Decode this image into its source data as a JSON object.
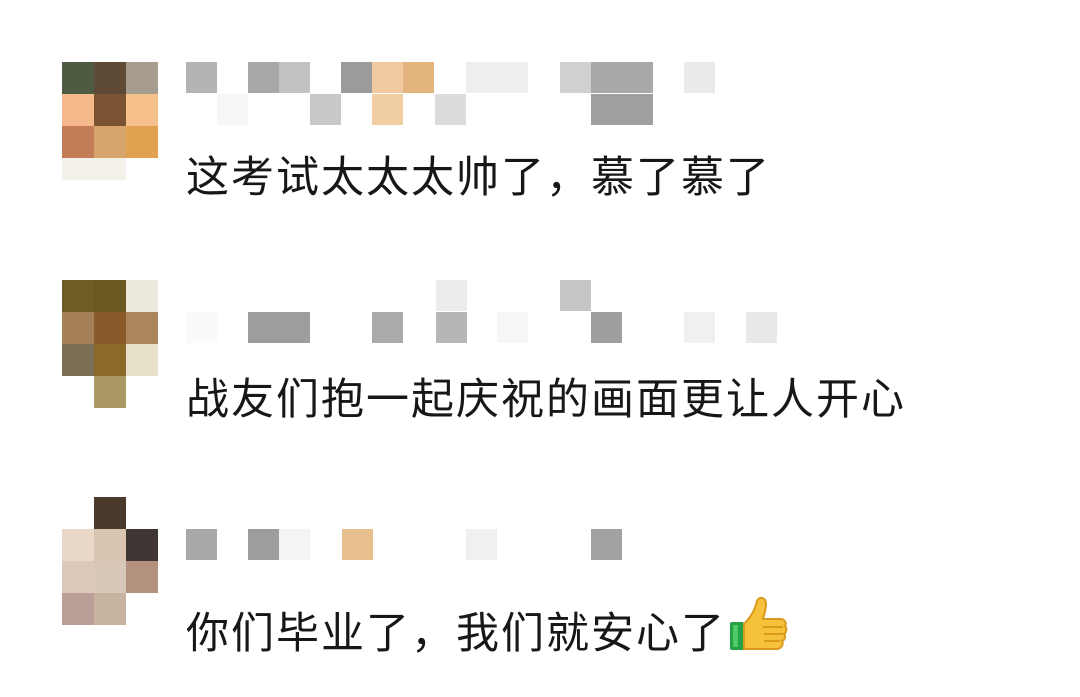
{
  "comments": [
    {
      "avatar_colors": [
        "#4f5b41",
        "#5e4a35",
        "#a69d8e",
        "#f5b98b",
        "#7b5332",
        "#f6c08c",
        "#c27d56",
        "#d7a56c",
        "#e0a24e",
        "#f4f0ea"
      ],
      "name_colors": [
        "#b4b4b4",
        "#a8a8a8",
        "#c2c2c2",
        "#dedede",
        "#9b9b9b",
        "#f0c9a1",
        "#e3b47d",
        "#eeeeee",
        "#d0d0d0",
        "#a9a9a9",
        "#eaeaea",
        "#c8c8c8",
        "#f0cda2",
        "#dcdcdc",
        "#9f9f9f"
      ],
      "text": "这考试太太太帅了，慕了慕了"
    },
    {
      "avatar_colors": [
        "#6d5c24",
        "#6a5a21",
        "#ebe8de",
        "#a57f57",
        "#8b5a2a",
        "#aa855e",
        "#7b6e55",
        "#8b6a28",
        "#e8e1c9",
        "#aa9963"
      ],
      "name_colors": [
        "#ececec",
        "#f0f0f0",
        "#c6c6c6",
        "#9d9d9d",
        "#aaaaaa",
        "#b6b6b6",
        "#d8d8d8",
        "#f7f7f7",
        "#bcbcbc",
        "#9e9e9e",
        "#f0f0f0",
        "#e8e8e8"
      ],
      "text": "战友们抱一起庆祝的画面更让人开心"
    },
    {
      "avatar_colors": [
        "#4a3a2c",
        "#e9d8c7",
        "#d8c4b0",
        "#3f3633",
        "#dbc8b8",
        "#d9c7b8",
        "#b3917d",
        "#b99f98",
        "#c8b2a0"
      ],
      "name_colors": [
        "#a9a9a9",
        "#9d9d9d",
        "#f4f4f4",
        "#e8c08e",
        "#f0f0f0",
        "#a2a2a2"
      ],
      "text": "你们毕业了，我们就安心了"
    }
  ],
  "emoji": "thumbs-up"
}
